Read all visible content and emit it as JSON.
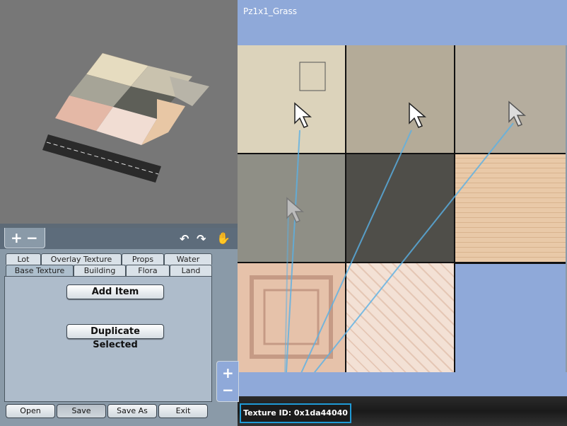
{
  "preview": {
    "label": "3D tile preview"
  },
  "toolbar": {
    "zoom_in": "+",
    "zoom_out": "−",
    "rotate_left": "↶",
    "rotate_right": "↷",
    "hand_icon": "✋"
  },
  "tabs_row1": [
    "Lot",
    "Overlay Texture",
    "Props",
    "Water"
  ],
  "tabs_row2": [
    "Base Texture",
    "Building",
    "Flora",
    "Land"
  ],
  "active_tab": "Base Texture",
  "actions": {
    "add_item": "Add Item",
    "duplicate_selected": "Duplicate Selected"
  },
  "bottom_buttons": {
    "open": "Open",
    "save": "Save",
    "save_as": "Save As",
    "exit": "Exit"
  },
  "header": {
    "title": "Pz1x1_Grass"
  },
  "side_zoom": {
    "plus": "+",
    "minus": "−"
  },
  "status": {
    "texture_id": "Texture ID: 0x1da44040"
  },
  "colors": {
    "accent_blue": "#8fa9d9",
    "highlight_border": "#1f9ad6",
    "panel_bg": "#8a9aa8"
  }
}
